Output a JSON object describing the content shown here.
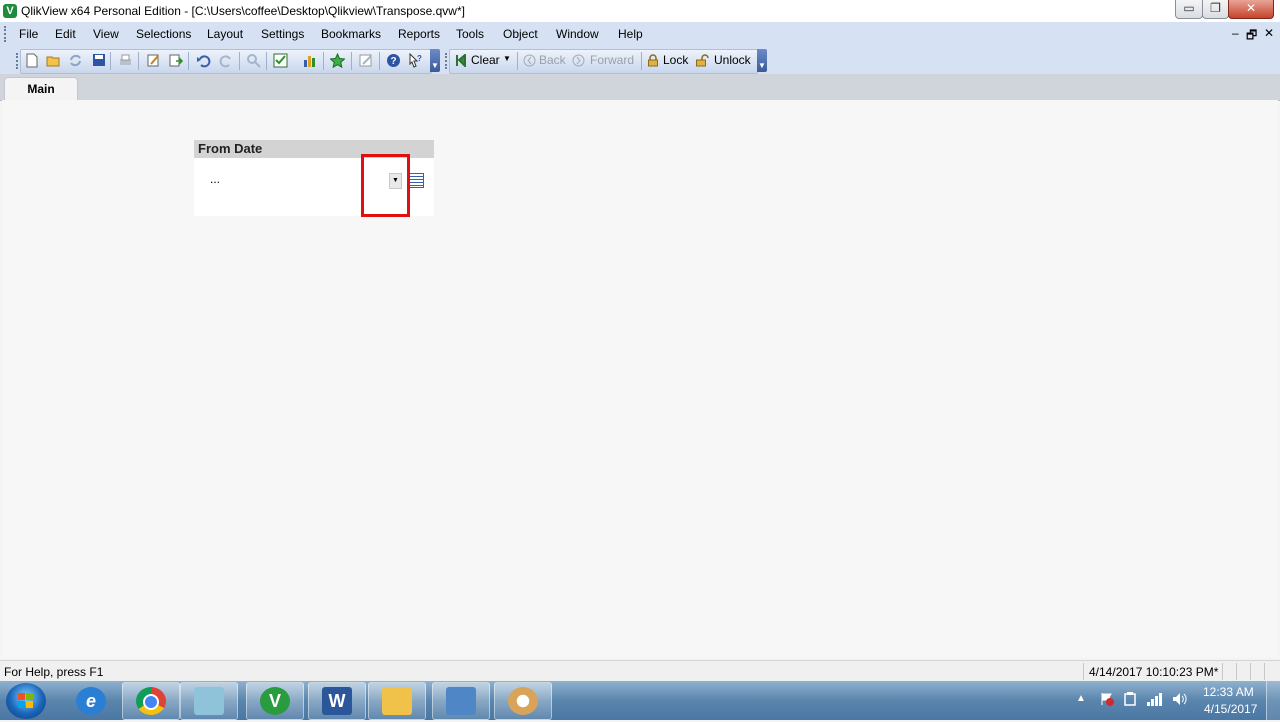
{
  "window": {
    "app_badge": "V",
    "title": "QlikView x64 Personal Edition - [C:\\Users\\coffee\\Desktop\\Qlikview\\Transpose.qvw*]",
    "minimize_glyph": "▭",
    "restore_glyph": "❐",
    "close_glyph": "✕"
  },
  "menu": {
    "items": [
      "File",
      "Edit",
      "View",
      "Selections",
      "Layout",
      "Settings",
      "Bookmarks",
      "Reports",
      "Tools",
      "Object",
      "Window",
      "Help"
    ],
    "mdi_minimize": "–",
    "mdi_restore": "🗗",
    "mdi_close": "✕"
  },
  "toolbar": {
    "icons": [
      "new-icon",
      "open-icon",
      "reload-icon",
      "save-icon",
      "print-icon",
      "edit-script-icon",
      "export-icon",
      "undo-icon",
      "redo-icon",
      "search-icon",
      "check-icon",
      "chart-icon",
      "star-icon",
      "edit-icon",
      "help-icon",
      "context-help-icon"
    ],
    "clear_label": "Clear",
    "back_label": "Back",
    "forward_label": "Forward",
    "lock_label": "Lock",
    "unlock_label": "Unlock"
  },
  "tabs": {
    "active": "Main"
  },
  "input_box": {
    "caption": "From Date",
    "value": "...",
    "dropdown_glyph": "▼"
  },
  "status": {
    "help": "For Help, press F1",
    "datetime": "4/14/2017 10:10:23 PM*"
  },
  "taskbar": {
    "apps": [
      "internet-explorer",
      "chrome",
      "file-explorer-like",
      "qlikview",
      "word",
      "file-explorer",
      "control-panel",
      "paint"
    ],
    "qlik_letter": "V",
    "word_letter": "W",
    "tray_up": "▲",
    "clock_time": "12:33 AM",
    "clock_date": "4/15/2017"
  }
}
